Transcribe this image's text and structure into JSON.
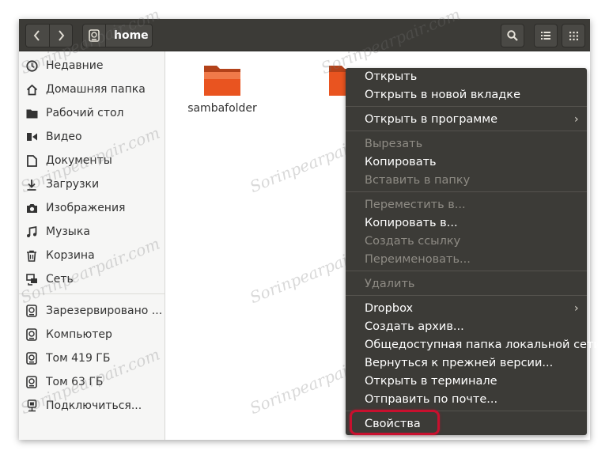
{
  "header": {
    "path_label": "home",
    "back_icon": "chevron-left-icon",
    "forward_icon": "chevron-right-icon",
    "search_icon": "search-icon",
    "list_icon": "list-view-icon",
    "grid_icon": "grid-view-icon"
  },
  "sidebar": {
    "items": [
      {
        "label": "Недавние",
        "icon": "clock-icon"
      },
      {
        "label": "Домашняя папка",
        "icon": "home-icon"
      },
      {
        "label": "Рабочий стол",
        "icon": "folder-icon"
      },
      {
        "label": "Видео",
        "icon": "video-icon"
      },
      {
        "label": "Документы",
        "icon": "document-icon"
      },
      {
        "label": "Загрузки",
        "icon": "download-icon"
      },
      {
        "label": "Изображения",
        "icon": "camera-icon"
      },
      {
        "label": "Музыка",
        "icon": "music-icon"
      },
      {
        "label": "Корзина",
        "icon": "trash-icon"
      },
      {
        "label": "Сеть",
        "icon": "network-icon"
      }
    ],
    "drives": [
      {
        "label": "Зарезервировано ...",
        "icon": "drive-icon"
      },
      {
        "label": "Компьютер",
        "icon": "drive-icon"
      },
      {
        "label": "Том 419 ГБ",
        "icon": "drive-icon"
      },
      {
        "label": "Том 63 ГБ",
        "icon": "drive-icon"
      },
      {
        "label": "Подключиться...",
        "icon": "connect-server-icon"
      }
    ]
  },
  "files": [
    {
      "label": "sambafolder",
      "icon": "folder-icon"
    }
  ],
  "context_menu": {
    "items": [
      {
        "label": "Открыть",
        "enabled": true
      },
      {
        "label": "Открыть в новой вкладке",
        "enabled": true
      },
      {
        "label": "Открыть в программе",
        "enabled": true,
        "submenu": true
      },
      {
        "label": "Вырезать",
        "enabled": false
      },
      {
        "label": "Копировать",
        "enabled": true
      },
      {
        "label": "Вставить в папку",
        "enabled": false
      },
      {
        "label": "Переместить в...",
        "enabled": false
      },
      {
        "label": "Копировать в...",
        "enabled": true
      },
      {
        "label": "Создать ссылку",
        "enabled": false
      },
      {
        "label": "Переименовать...",
        "enabled": false
      },
      {
        "label": "Удалить",
        "enabled": false
      },
      {
        "label": "Dropbox",
        "enabled": true,
        "submenu": true
      },
      {
        "label": "Создать архив...",
        "enabled": true
      },
      {
        "label": "Общедоступная папка локальной сети",
        "enabled": true
      },
      {
        "label": "Вернуться к прежней версии...",
        "enabled": true
      },
      {
        "label": "Открыть в терминале",
        "enabled": true
      },
      {
        "label": "Отправить по почте...",
        "enabled": true
      },
      {
        "label": "Свойства",
        "enabled": true,
        "highlighted": true
      }
    ]
  },
  "watermark": "Sorinpearpair.com",
  "colors": {
    "headerbar": "#3c3b37",
    "menu_bg": "#3c3b37",
    "folder_orange": "#e95420",
    "highlight_red": "#c8102e"
  }
}
